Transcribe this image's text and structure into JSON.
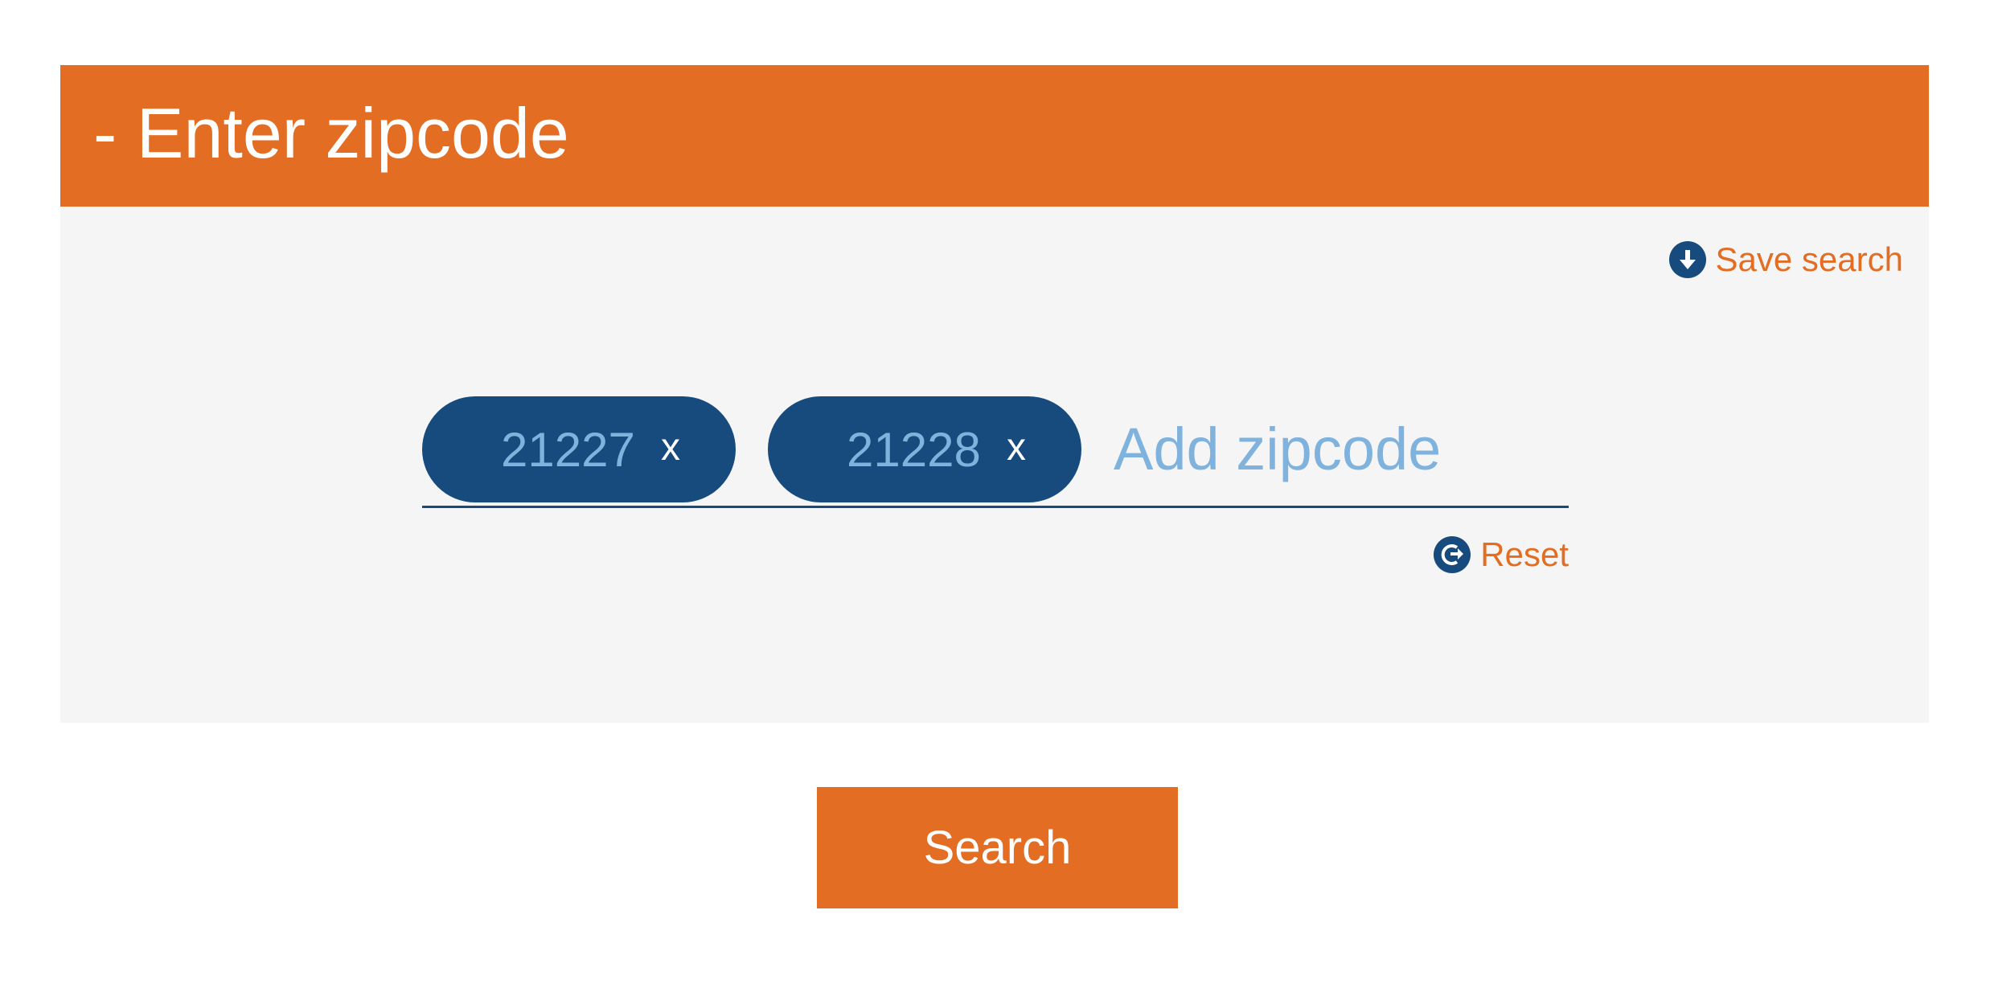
{
  "panel": {
    "title": "- Enter zipcode",
    "header_color": "#e26d23",
    "body_color": "#f5f5f5"
  },
  "save_search": {
    "icon": "download-arrow-icon",
    "label": "Save search"
  },
  "zipcode_field": {
    "chips": [
      {
        "value": "21227",
        "remove_label": "x"
      },
      {
        "value": "21228",
        "remove_label": "x"
      }
    ],
    "placeholder": "Add zipcode",
    "value": ""
  },
  "reset": {
    "icon": "reset-arrow-icon",
    "label": "Reset"
  },
  "search_button": {
    "label": "Search"
  },
  "colors": {
    "accent": "#e26d23",
    "chip_background": "#174a7d",
    "chip_text": "#7fb2dc"
  }
}
